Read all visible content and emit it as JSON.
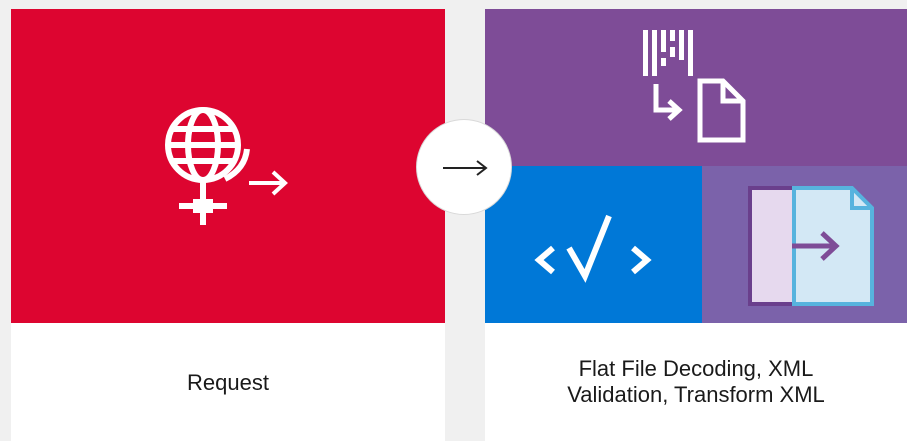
{
  "steps": [
    {
      "label": "Request",
      "icon": "globe-request-icon",
      "color": "#dd0530"
    },
    {
      "label_lines": [
        "Flat File Decoding, XML",
        "Validation, Transform XML"
      ],
      "tiles": [
        {
          "icon": "flat-file-decoding-icon",
          "color": "#7e4c97"
        },
        {
          "icon": "xml-validation-icon",
          "color": "#0078d7"
        },
        {
          "icon": "transform-xml-icon",
          "color": "#7b62aa"
        }
      ]
    }
  ],
  "connector": {
    "icon": "arrow-right-icon"
  }
}
